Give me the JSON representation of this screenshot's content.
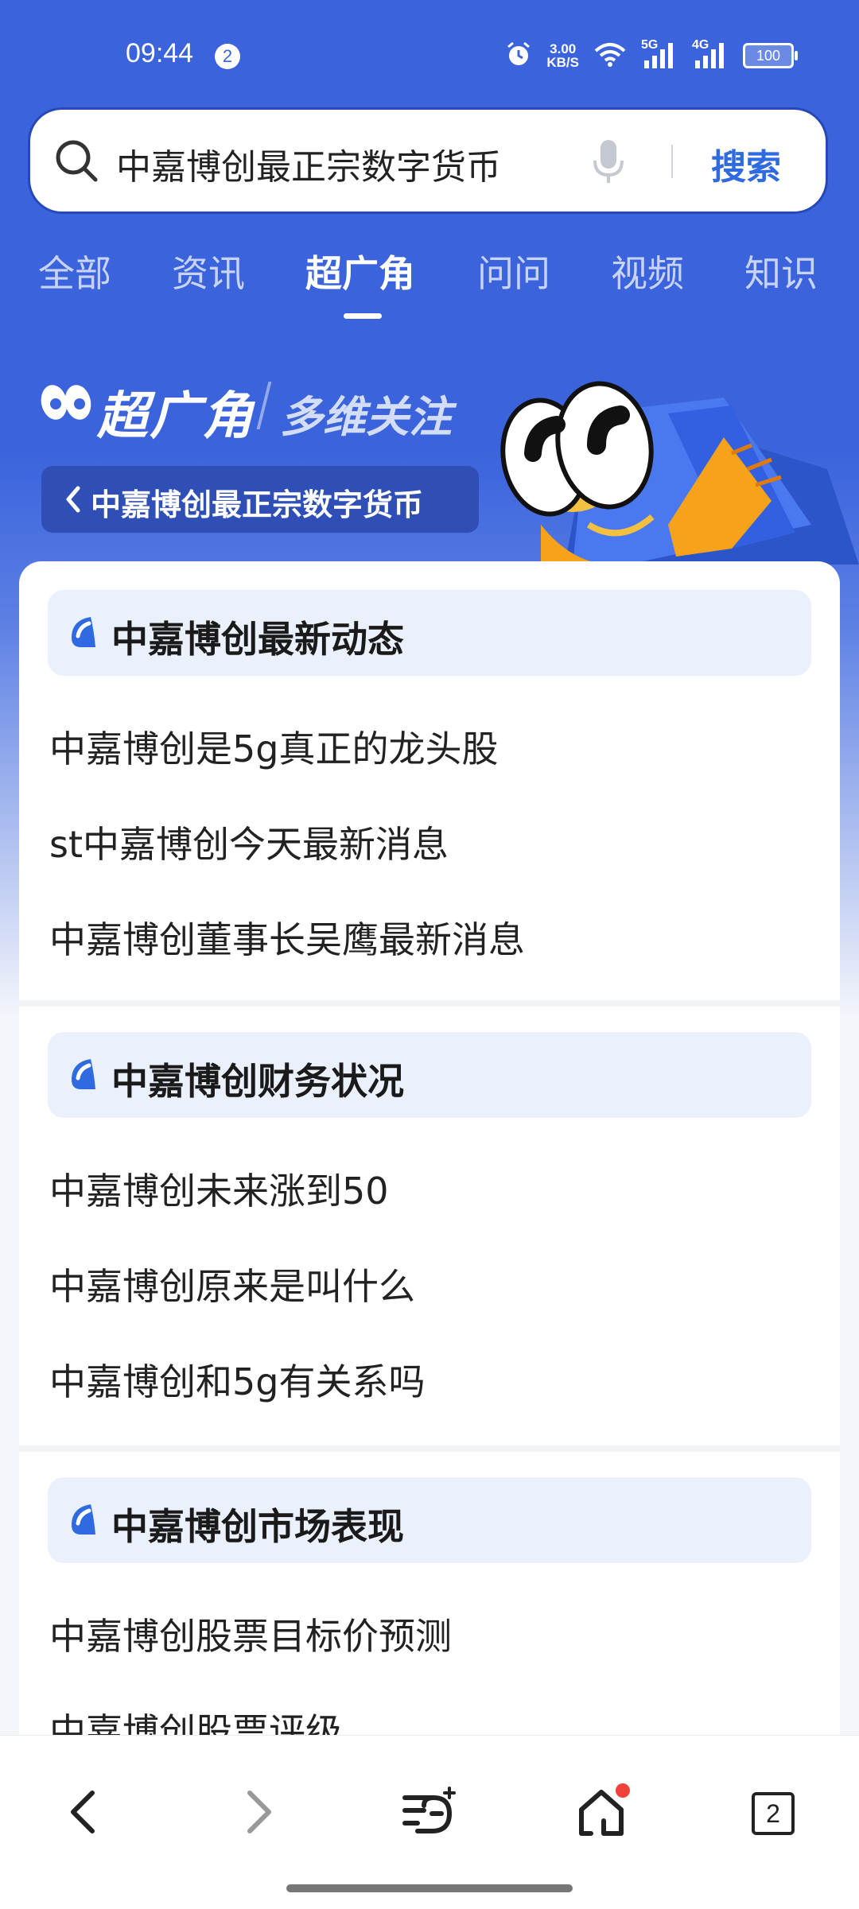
{
  "status_bar": {
    "time": "09:44",
    "notification_count": "2",
    "net_speed_value": "3.00",
    "net_speed_unit": "KB/S",
    "sim1_label": "5G",
    "sim2_label": "4G",
    "battery": "100"
  },
  "search": {
    "query": "中嘉博创最正宗数字货币",
    "button_label": "搜索"
  },
  "tabs": [
    {
      "label": "全部"
    },
    {
      "label": "资讯"
    },
    {
      "label": "超广角",
      "active": true
    },
    {
      "label": "问问"
    },
    {
      "label": "视频"
    },
    {
      "label": "知识"
    }
  ],
  "hero": {
    "title": "超广角",
    "subtitle": "多维关注",
    "back_chip_label": "中嘉博创最正宗数字货币"
  },
  "sections": [
    {
      "title": "中嘉博创最新动态",
      "items": [
        "中嘉博创是5g真正的龙头股",
        "st中嘉博创今天最新消息",
        "中嘉博创董事长吴鹰最新消息"
      ]
    },
    {
      "title": "中嘉博创财务状况",
      "items": [
        "中嘉博创未来涨到50",
        "中嘉博创原来是叫什么",
        "中嘉博创和5g有关系吗"
      ]
    },
    {
      "title": "中嘉博创市场表现",
      "items": [
        "中嘉博创股票目标价预测",
        "中嘉博创股票评级"
      ]
    }
  ],
  "bottom_nav": {
    "tab_count": "2"
  },
  "colors": {
    "brand_blue": "#3a63dc",
    "accent_blue": "#2f6ae0",
    "section_head_bg": "#eaf1fd",
    "notification_red": "#f0413a"
  }
}
